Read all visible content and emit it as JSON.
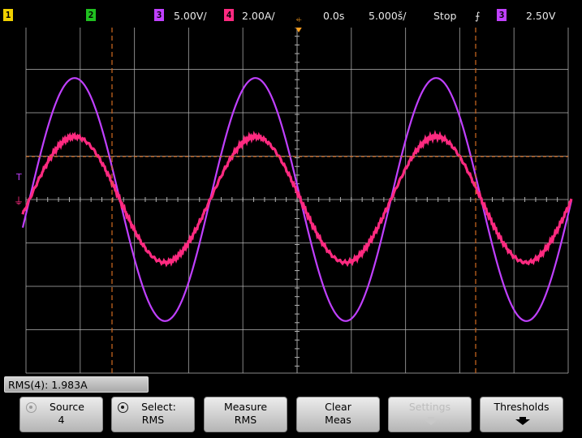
{
  "status_bar": {
    "ch1_label": "1",
    "ch2_label": "2",
    "ch3_label": "3",
    "ch3_scale": "5.00V/",
    "ch4_label": "4",
    "ch4_scale": "2.00A/",
    "delay": "0.0s",
    "timebase": "5.000š/",
    "run_state": "Stop",
    "trigger_source": "3",
    "trigger_level": "2.50V"
  },
  "colors": {
    "ch3_trace": "#c040ff",
    "ch4_trace": "#ff2a80",
    "grid": "#b4b4b4",
    "cursor": "#d06a20",
    "trigger_marker": "#ffa020"
  },
  "measurement": {
    "readout": "RMS(4): 1.983A"
  },
  "softkeys": [
    {
      "line1": "Source",
      "line2": "4",
      "icon": "rotate-knob-icon",
      "enabled": true
    },
    {
      "line1": "Select:",
      "line2": "RMS",
      "icon": "rotate-knob-icon",
      "enabled": true
    },
    {
      "line1": "Measure",
      "line2": "RMS",
      "enabled": true
    },
    {
      "line1": "Clear",
      "line2": "Meas",
      "enabled": true
    },
    {
      "line1": "Settings",
      "line2": "",
      "icon": "down-arrow-icon",
      "enabled": false
    },
    {
      "line1": "Thresholds",
      "line2": "",
      "icon": "down-arrow-icon",
      "enabled": true
    }
  ],
  "waveform": {
    "ch3_peak_divisions": 2.8,
    "ch4_peak_divisions": 1.45,
    "cycles_visible": 3.0
  }
}
